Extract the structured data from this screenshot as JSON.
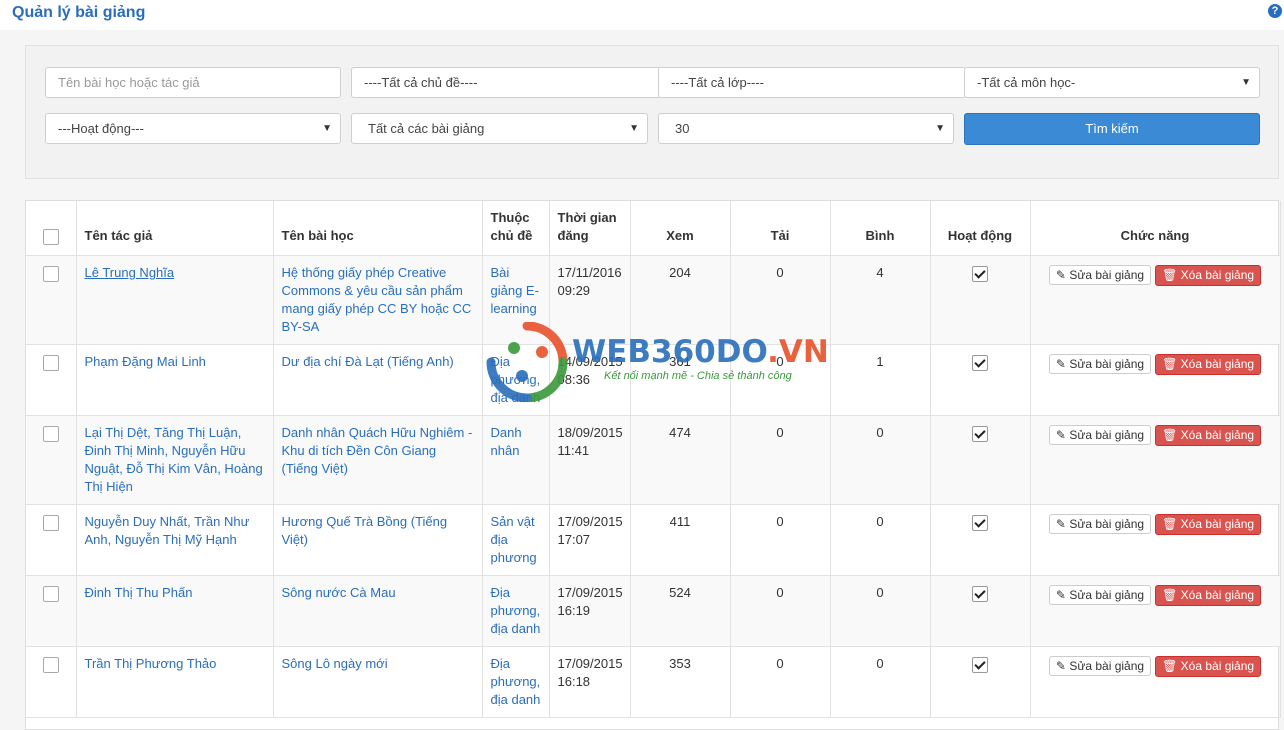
{
  "page": {
    "title": "Quản lý bài giảng",
    "help_icon": "help-icon"
  },
  "filters": {
    "search_placeholder": "Tên bài học hoặc tác giả",
    "topic": "----Tất cả chủ đề----",
    "class": "----Tất cả lớp----",
    "subject": "-Tất cả môn học-",
    "status": "---Hoạt động---",
    "lecture_type": "Tất cả các bài giảng",
    "per_page": "30",
    "search_button": "Tìm kiếm"
  },
  "table": {
    "headers": {
      "author": "Tên tác giả",
      "lesson": "Tên bài học",
      "topic": "Thuộc chủ đề",
      "posted": "Thời gian đăng",
      "views": "Xem",
      "downloads": "Tải",
      "comments": "Bình",
      "active": "Hoạt động",
      "actions": "Chức năng"
    },
    "edit_label": "Sửa bài giảng",
    "delete_label": "Xóa bài giảng",
    "rows": [
      {
        "author": "Lê Trung Nghĩa",
        "lesson": "Hệ thống giấy phép Creative Commons & yêu cầu sản phẩm mang giấy phép CC BY hoặc CC BY-SA",
        "topic": "Bài giảng E-learning",
        "posted": "17/11/2016 09:29",
        "views": "204",
        "downloads": "0",
        "comments": "4",
        "active": true
      },
      {
        "author": "Phạm Đặng Mai Linh",
        "lesson": "Dư địa chí Đà Lạt (Tiếng Anh)",
        "topic": "Địa phương, địa danh",
        "posted": "14/09/2015 08:36",
        "views": "361",
        "downloads": "0",
        "comments": "1",
        "active": true
      },
      {
        "author": "Lại Thị Dệt, Tăng Thị Luận, Đinh Thị Minh, Nguyễn Hữu Nguật, Đỗ Thị Kim Vân, Hoàng Thị Hiện",
        "lesson": "Danh nhân Quách Hữu Nghiêm - Khu di tích Đền Côn Giang (Tiếng Việt)",
        "topic": "Danh nhân",
        "posted": "18/09/2015 11:41",
        "views": "474",
        "downloads": "0",
        "comments": "0",
        "active": true
      },
      {
        "author": "Nguyễn Duy Nhất, Trần Như Anh, Nguyễn Thị Mỹ Hạnh",
        "lesson": "Hương Quế Trà Bồng (Tiếng Việt)",
        "topic": "Sản vật địa phương",
        "posted": "17/09/2015 17:07",
        "views": "411",
        "downloads": "0",
        "comments": "0",
        "active": true
      },
      {
        "author": "Đinh Thị Thu Phấn",
        "lesson": "Sông nước Cà Mau",
        "topic": "Địa phương, địa danh",
        "posted": "17/09/2015 16:19",
        "views": "524",
        "downloads": "0",
        "comments": "0",
        "active": true
      },
      {
        "author": "Trần Thị Phương Thảo",
        "lesson": "Sông Lô ngày mới",
        "topic": "Địa phương, địa danh",
        "posted": "17/09/2015 16:18",
        "views": "353",
        "downloads": "0",
        "comments": "0",
        "active": true
      }
    ]
  },
  "watermark": {
    "brand_main": "WEB360DO",
    "brand_suffix": ".VN",
    "slogan": "Kết nối mạnh mẽ - Chia sẻ thành công"
  },
  "colors": {
    "accent": "#2a6ebb",
    "search_button": "#3a8ad6",
    "delete_button": "#d9534f"
  }
}
